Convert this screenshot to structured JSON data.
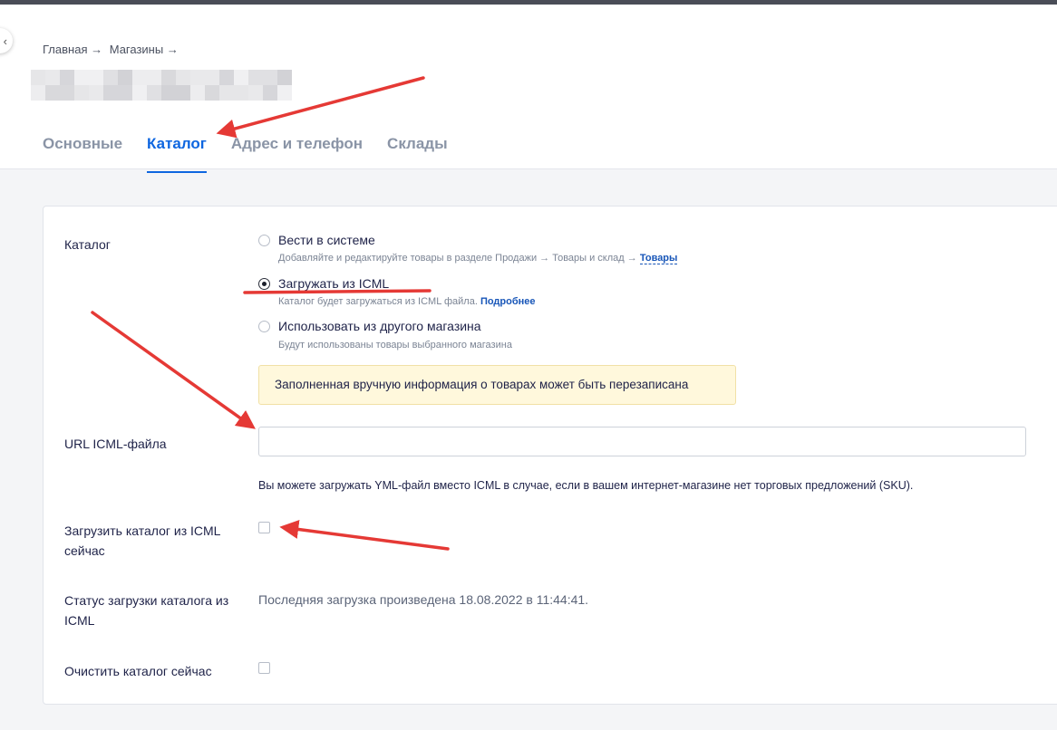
{
  "breadcrumb": {
    "home": "Главная →",
    "shops": "Магазины →"
  },
  "tabs": [
    {
      "label": "Основные"
    },
    {
      "label": "Каталог"
    },
    {
      "label": "Адрес и телефон"
    },
    {
      "label": "Склады"
    }
  ],
  "catalog": {
    "label": "Каталог",
    "options": [
      {
        "label": "Вести в системе",
        "hint": "Добавляйте и редактируйте товары в разделе Продажи → Товары и склад →",
        "hint_link": "Товары",
        "checked": false
      },
      {
        "label": "Загружать из ICML",
        "hint": "Каталог будет загружаться из ICML файла.",
        "hint_link": "Подробнее",
        "checked": true
      },
      {
        "label": "Использовать из другого магазина",
        "hint": "Будут использованы товары выбранного магазина",
        "checked": false
      }
    ],
    "warning": "Заполненная вручную информация о товарах может быть перезаписана"
  },
  "url_field": {
    "label": "URL ICML-файла",
    "value": "",
    "note": "Вы можете загружать YML-файл вместо ICML в случае, если в вашем интернет-магазине нет торговых предложений (SKU)."
  },
  "load_now": {
    "label": "Загрузить каталог из ICML сейчас",
    "checked": false
  },
  "status": {
    "label": "Статус загрузки каталога из ICML",
    "text": "Последняя загрузка произведена 18.08.2022 в 11:44:41."
  },
  "clear_now": {
    "label": "Очистить каталог сейчас",
    "checked": false
  },
  "colors": {
    "accent": "#0e66e0",
    "annotation": "#e53935",
    "warning_bg": "#fff8dc"
  }
}
